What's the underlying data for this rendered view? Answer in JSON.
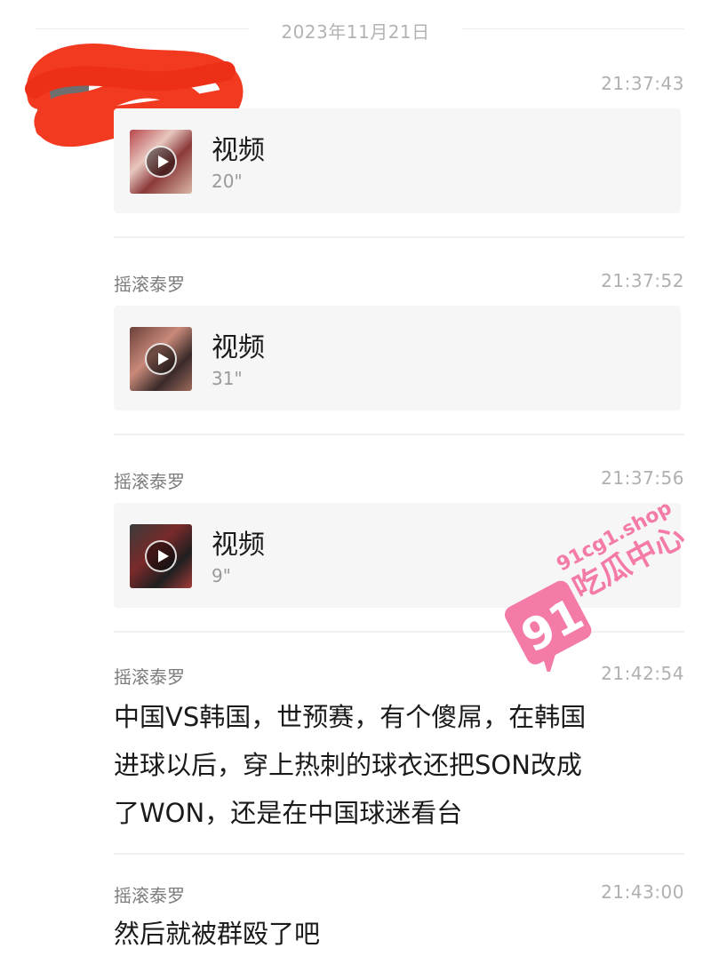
{
  "date_separator": "2023年11月21日",
  "messages": [
    {
      "sender": "",
      "time": "21:37:43",
      "card": {
        "title": "视频",
        "duration": "20\""
      }
    },
    {
      "sender": "摇滚泰罗",
      "time": "21:37:52",
      "card": {
        "title": "视频",
        "duration": "31\""
      }
    },
    {
      "sender": "摇滚泰罗",
      "time": "21:37:56",
      "card": {
        "title": "视频",
        "duration": "9\""
      }
    },
    {
      "sender": "摇滚泰罗",
      "time": "21:42:54",
      "text": "中国VS韩国，世预赛，有个傻屌，在韩国\n进球以后，穿上热刺的球衣还把SON改成\n了WON，还是在中国球迷看台"
    },
    {
      "sender": "摇滚泰罗",
      "time": "21:43:00",
      "text": "然后就被群殴了吧"
    }
  ],
  "watermark": {
    "number": "91",
    "site": "91cg1.shop",
    "name": "吃瓜中心",
    "color": "#f47aa8"
  },
  "icons": {
    "play": "play-icon",
    "redaction": "red-scribble"
  }
}
